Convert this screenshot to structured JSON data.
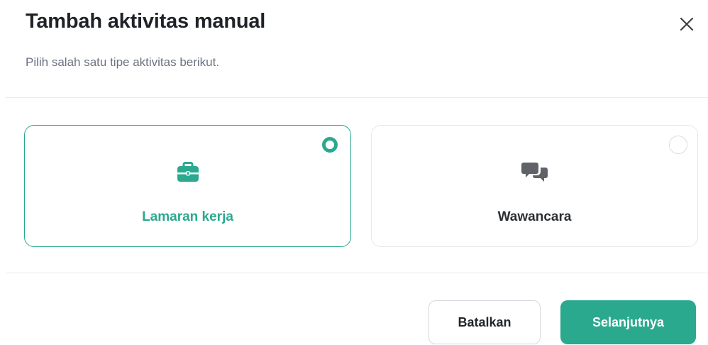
{
  "dialog": {
    "title": "Tambah aktivitas manual",
    "subtitle": "Pilih salah satu tipe aktivitas berikut.",
    "close_icon": "close-icon"
  },
  "options": [
    {
      "label": "Lamaran kerja",
      "icon": "briefcase-icon",
      "selected": true
    },
    {
      "label": "Wawancara",
      "icon": "chat-bubbles-icon",
      "selected": false
    }
  ],
  "footer": {
    "cancel_label": "Batalkan",
    "next_label": "Selanjutnya"
  },
  "colors": {
    "accent": "#2aa98f",
    "text_primary": "#1f2328",
    "text_secondary": "#6b7280",
    "icon_muted": "#5f6368",
    "border": "#e5e7eb"
  }
}
